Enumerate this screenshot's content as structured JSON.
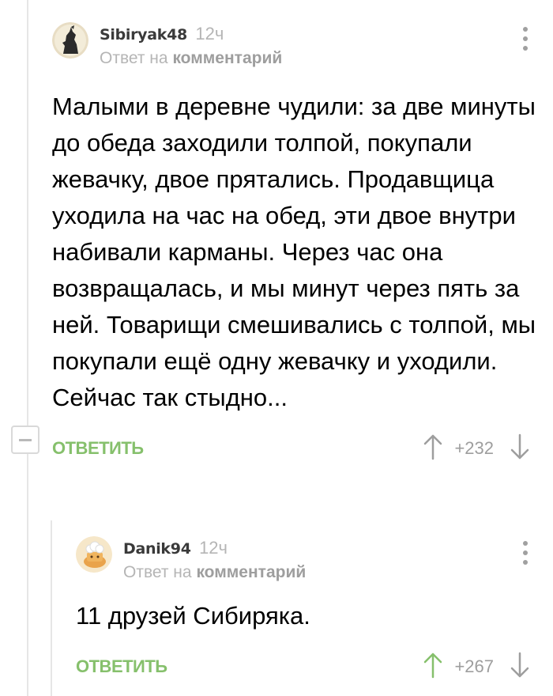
{
  "colors": {
    "accent_green": "#86c06c",
    "muted_text": "#b5b5b5",
    "thread_line": "#e6e6e6"
  },
  "comments": [
    {
      "author": "Sibiryak48",
      "time": "12ч",
      "reply_to_prefix": "Ответ на",
      "reply_to_link": "комментарий",
      "text": "Малыми в деревне чудили: за две минуты до обеда заходили толпой, покупали жевачку, двое прятались. Продавщица уходила на час на обед, эти двое внутри набивали карманы. Через час она возвращалась, и мы минут через пять за ней. Товарищи смешивались с толпой, мы покупали ещё одну жевачку и уходили. Сейчас так стыдно...",
      "reply_label": "ОТВЕТИТЬ",
      "score": "+232",
      "avatar_icon": "wolf-howling-icon",
      "upvoted": false
    },
    {
      "author": "Danik94",
      "time": "12ч",
      "reply_to_prefix": "Ответ на",
      "reply_to_link": "комментарий",
      "text": "11 друзей Сибиряка.",
      "reply_label": "ОТВЕТИТЬ",
      "score": "+267",
      "avatar_icon": "chef-bread-icon",
      "upvoted": true
    }
  ]
}
